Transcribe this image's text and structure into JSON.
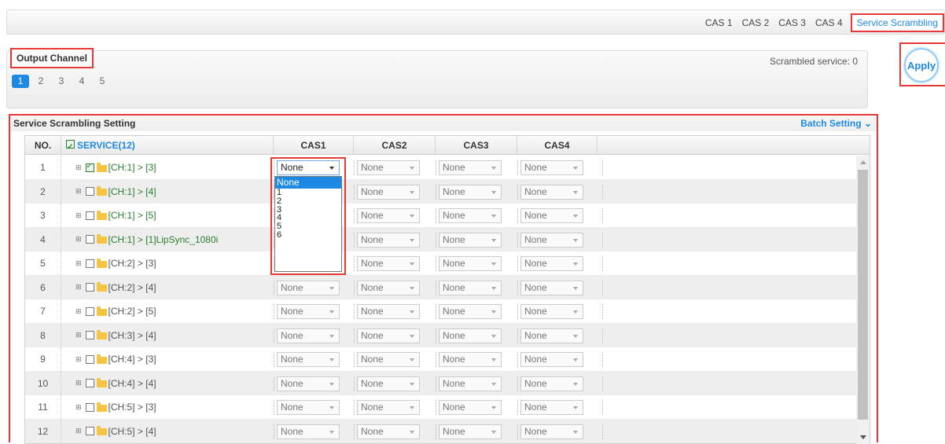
{
  "tabs": [
    {
      "label": "CAS 1"
    },
    {
      "label": "CAS 2"
    },
    {
      "label": "CAS 3"
    },
    {
      "label": "CAS 4"
    },
    {
      "label": "Service Scrambling",
      "active": true
    }
  ],
  "output_channel": {
    "title": "Output Channel",
    "scrambled_label": "Scrambled service: 0",
    "pages": [
      "1",
      "2",
      "3",
      "4",
      "5"
    ],
    "active_page": "1"
  },
  "apply_label": "Apply",
  "setting": {
    "title": "Service Scrambling Setting",
    "batch_label": "Batch Setting",
    "headers": {
      "no": "NO.",
      "service": "SERVICE(12)",
      "cas1": "CAS1",
      "cas2": "CAS2",
      "cas3": "CAS3",
      "cas4": "CAS4"
    },
    "rows": [
      {
        "no": "1",
        "service": "[CH:1] > [3]",
        "checked": true,
        "green": true,
        "cas": [
          "None",
          "None",
          "None",
          "None"
        ]
      },
      {
        "no": "2",
        "service": "[CH:1] > [4]",
        "checked": false,
        "green": true,
        "cas": [
          "None",
          "None",
          "None",
          "None"
        ]
      },
      {
        "no": "3",
        "service": "[CH:1] > [5]",
        "checked": false,
        "green": true,
        "cas": [
          "None",
          "None",
          "None",
          "None"
        ]
      },
      {
        "no": "4",
        "service": "[CH:1] > [1]LipSync_1080i",
        "checked": false,
        "green": true,
        "cas": [
          "None",
          "None",
          "None",
          "None"
        ]
      },
      {
        "no": "5",
        "service": "[CH:2] > [3]",
        "checked": false,
        "green": false,
        "cas": [
          "None",
          "None",
          "None",
          "None"
        ]
      },
      {
        "no": "6",
        "service": "[CH:2] > [4]",
        "checked": false,
        "green": false,
        "cas": [
          "None",
          "None",
          "None",
          "None"
        ]
      },
      {
        "no": "7",
        "service": "[CH:2] > [5]",
        "checked": false,
        "green": false,
        "cas": [
          "None",
          "None",
          "None",
          "None"
        ]
      },
      {
        "no": "8",
        "service": "[CH:3] > [4]",
        "checked": false,
        "green": false,
        "cas": [
          "None",
          "None",
          "None",
          "None"
        ]
      },
      {
        "no": "9",
        "service": "[CH:4] > [3]",
        "checked": false,
        "green": false,
        "cas": [
          "None",
          "None",
          "None",
          "None"
        ]
      },
      {
        "no": "10",
        "service": "[CH:4] > [4]",
        "checked": false,
        "green": false,
        "cas": [
          "None",
          "None",
          "None",
          "None"
        ]
      },
      {
        "no": "11",
        "service": "[CH:5] > [3]",
        "checked": false,
        "green": false,
        "cas": [
          "None",
          "None",
          "None",
          "None"
        ]
      },
      {
        "no": "12",
        "service": "[CH:5] > [4]",
        "checked": false,
        "green": false,
        "cas": [
          "None",
          "None",
          "None",
          "None"
        ]
      }
    ]
  },
  "dropdown": {
    "options": [
      "None",
      "1",
      "2",
      "3",
      "4",
      "5",
      "6"
    ],
    "highlighted": "None"
  },
  "colors": {
    "accent": "#1e88e5",
    "highlight_border": "#e53935",
    "service_green": "#2e7d32"
  }
}
